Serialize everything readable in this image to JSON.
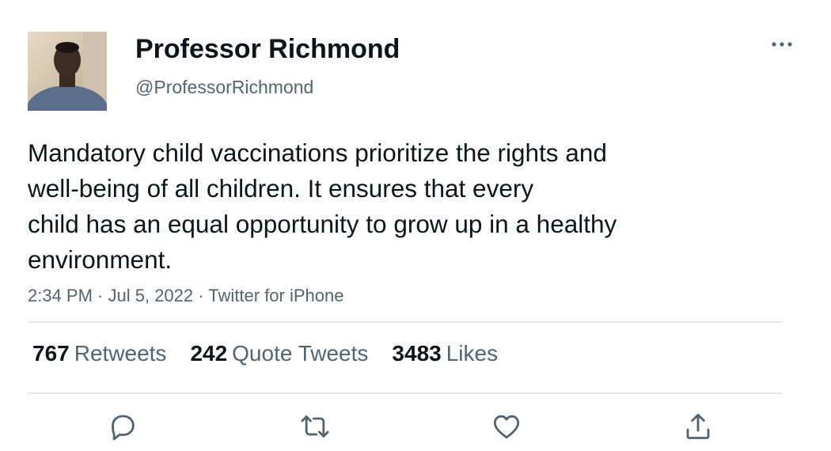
{
  "author": {
    "display_name": "Professor Richmond",
    "handle": "@ProfessorRichmond"
  },
  "tweet": {
    "lines": [
      "Mandatory child vaccinations prioritize the rights and",
      "well-being of all children. It ensures that every",
      "child has an equal opportunity to grow up in a healthy",
      "environment."
    ],
    "time": "2:34 PM",
    "date": "Jul 5, 2022",
    "source": "Twitter for iPhone",
    "separator": " · "
  },
  "stats": {
    "retweets_count": "767",
    "retweets_label": "Retweets",
    "quotes_count": "242",
    "quotes_label": "Quote Tweets",
    "likes_count": "3483",
    "likes_label": "Likes"
  },
  "icons": {
    "more": "more-horizontal-icon",
    "reply": "reply-icon",
    "retweet": "retweet-icon",
    "like": "heart-icon",
    "share": "share-icon"
  },
  "colors": {
    "text": "#0f1419",
    "secondary": "#536471",
    "divider": "#e3e5e8",
    "icon": "#536471"
  }
}
